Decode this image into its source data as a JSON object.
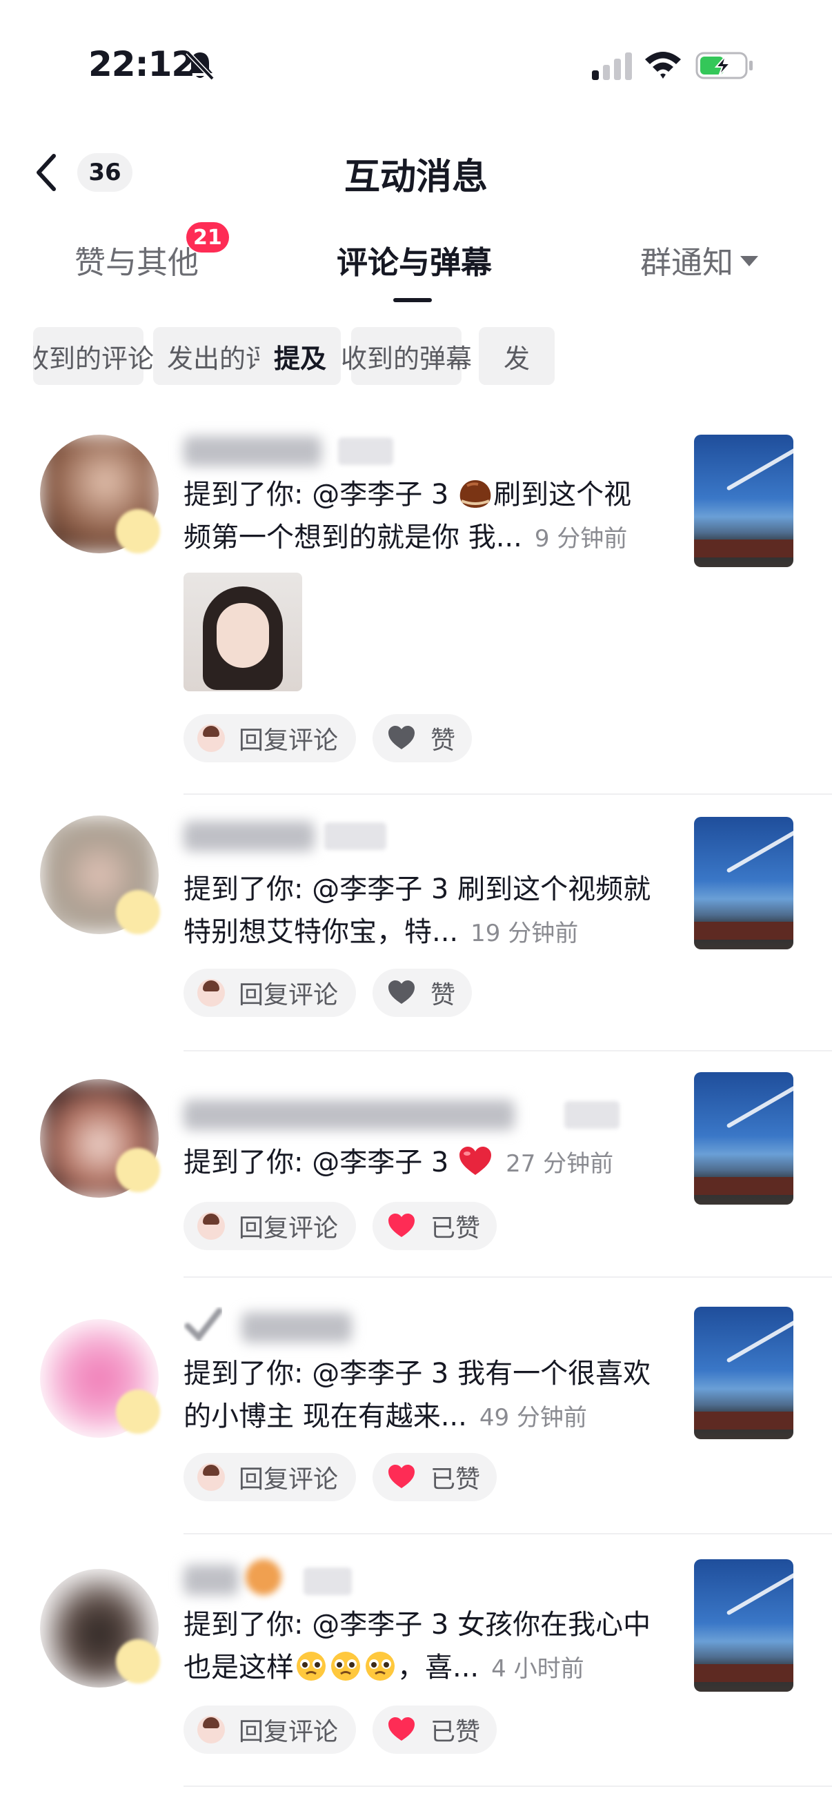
{
  "status_bar": {
    "time": "22:12"
  },
  "header": {
    "back_count": "36",
    "title": "互动消息"
  },
  "tabs": {
    "likes": {
      "label": "赞与其他",
      "badge": "21"
    },
    "comments": {
      "label": "评论与弹幕"
    },
    "group": {
      "label": "群通知"
    }
  },
  "filters": [
    "收到的评论",
    "发出的评论",
    "提及",
    "收到的弹幕",
    "发"
  ],
  "active_filter": "提及",
  "items": [
    {
      "text": "提到了你: @李李子 3 ",
      "text2": "刷到这个视频第一个想到的就是你 我...",
      "time": "9 分钟前",
      "reply_label": "回复评论",
      "like_label": "赞",
      "liked": false
    },
    {
      "text": "提到了你: @李李子 3 刷到这个视频就特别想艾特你宝，特...",
      "time": "19 分钟前",
      "reply_label": "回复评论",
      "like_label": "赞",
      "liked": false
    },
    {
      "text": "提到了你: @李李子 3 ",
      "time": "27 分钟前",
      "reply_label": "回复评论",
      "like_label": "已赞",
      "liked": true
    },
    {
      "text": "提到了你: @李李子 3 我有一个很喜欢的小博主 现在有越来...",
      "time": "49 分钟前",
      "reply_label": "回复评论",
      "like_label": "已赞",
      "liked": true
    },
    {
      "text": "提到了你: @李李子 3 女孩你在我心中也是这样",
      "text2": "，喜...",
      "time": "4 小时前",
      "reply_label": "回复评论",
      "like_label": "已赞",
      "liked": true
    }
  ],
  "colors": {
    "accent": "#fe2c55",
    "text": "#161823",
    "secondary": "#8a8b91",
    "chip_bg": "#f1f1f2"
  }
}
